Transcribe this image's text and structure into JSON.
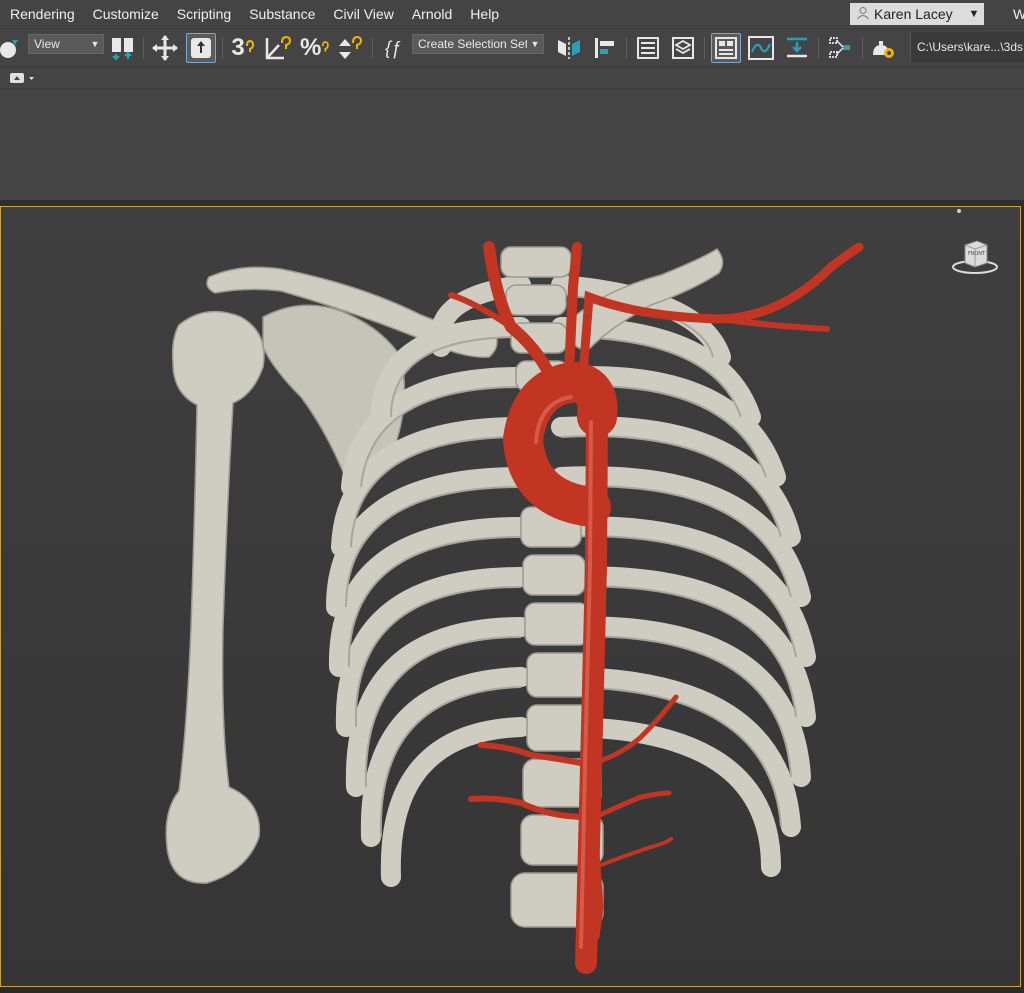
{
  "menu": {
    "items": [
      "Rendering",
      "Customize",
      "Scripting",
      "Substance",
      "Civil View",
      "Arnold",
      "Help"
    ],
    "user_name": "Karen Lacey",
    "workspace_label": "W"
  },
  "toolbar": {
    "reference_coord_value": "View",
    "percent_snap_glyph": "%",
    "snap3_glyph": "3",
    "named_selection_value": "Create Selection Set",
    "script_glyph": "{ƒ",
    "project_path": "C:\\Users\\kare...\\3ds"
  },
  "viewport": {
    "viewcube_label": "FRONT"
  },
  "colors": {
    "chrome": "#444444",
    "viewport_bg": "#3d3d3d",
    "active_border": "#c9a43a",
    "bone": "#cfcdc2",
    "artery": "#c23522"
  },
  "icons": [
    "snap-toggle-icon",
    "bind-to-space-warp-icon",
    "select-and-move-icon",
    "select-object-icon",
    "angle-snap-icon",
    "spinner-snap-icon",
    "edit-named-selection-icon",
    "mirror-icon",
    "align-icon",
    "scene-explorer-icon",
    "layer-explorer-icon",
    "ribbon-toggle-icon",
    "curve-editor-icon",
    "dope-sheet-icon",
    "schematic-view-icon",
    "render-setup-icon",
    "user-icon",
    "viewcube-icon"
  ]
}
